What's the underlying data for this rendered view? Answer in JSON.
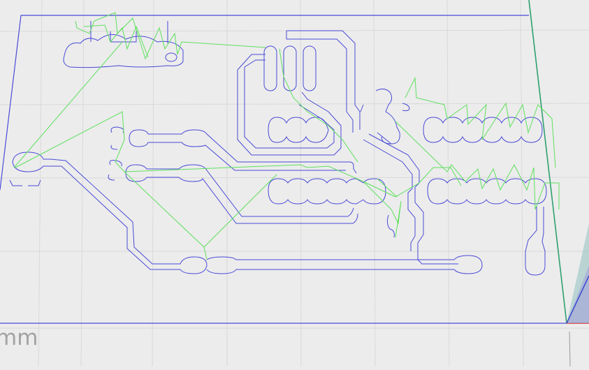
{
  "view": {
    "unit_label": "mm",
    "colors": {
      "background": "#ececec",
      "grid": "#d9d9d9",
      "board_outline": "#4a4ad8",
      "traces": "#4a4ad8",
      "rapid_moves": "#5ee05e",
      "axis_x": "#e03030",
      "axis_y": "#2fa070",
      "axis_z": "#3040d0"
    }
  }
}
